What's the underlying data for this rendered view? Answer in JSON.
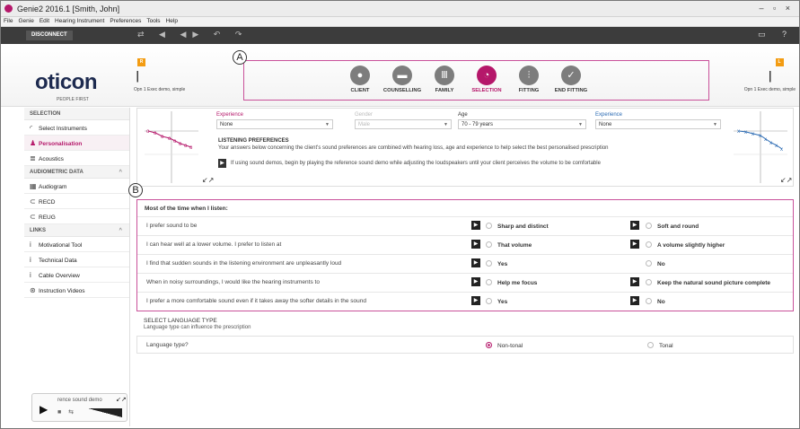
{
  "window": {
    "title": "Genie2 2016.1 [Smith, John]",
    "controls": "– ▫ ×"
  },
  "menu": [
    "File",
    "Genie",
    "Edit",
    "Hearing Instrument",
    "Preferences",
    "Tools",
    "Help"
  ],
  "toolbar": {
    "disconnect_label": "DISCONNECT",
    "icons": "⇄ ◀ ◀▶ ↶ ↷",
    "right_icons": "▭ ?"
  },
  "brand": {
    "logo": "oticon",
    "tagline": "PEOPLE FIRST"
  },
  "left_instrument": {
    "badge": "R",
    "label": "Opn 1 Exec demo, simple"
  },
  "right_instrument": {
    "badge": "L",
    "label": "Opn 1 Exec demo, simple"
  },
  "callouts": {
    "a": "A",
    "b": "B"
  },
  "steps": [
    {
      "label": "CLIENT",
      "icon": "person-icon",
      "glyph": "●"
    },
    {
      "label": "COUNSELLING",
      "icon": "chat-icon",
      "glyph": "▬"
    },
    {
      "label": "FAMILY",
      "icon": "family-icon",
      "glyph": "Ⅲ"
    },
    {
      "label": "SELECTION",
      "icon": "selection-icon",
      "glyph": "◔"
    },
    {
      "label": "FITTING",
      "icon": "sliders-icon",
      "glyph": "⫶"
    },
    {
      "label": "END FITTING",
      "icon": "check-icon",
      "glyph": "✓"
    }
  ],
  "colors": {
    "accent": "#b5176a",
    "right_ear": "#2a6ab3",
    "left_ear": "#c0392b"
  },
  "sidebar": {
    "selection": {
      "header": "SELECTION",
      "items": [
        {
          "label": "Select Instruments",
          "icon": "◜"
        },
        {
          "label": "Personalisation",
          "icon": "♟"
        },
        {
          "label": "Acoustics",
          "icon": "≣"
        }
      ]
    },
    "audiometric": {
      "header": "AUDIOMETRIC DATA",
      "caret": "^",
      "items": [
        {
          "label": "Audiogram",
          "icon": "▦"
        },
        {
          "label": "RECD",
          "icon": "⊂"
        },
        {
          "label": "REUG",
          "icon": "⊂"
        }
      ]
    },
    "links": {
      "header": "LINKS",
      "caret": "^",
      "items": [
        {
          "label": "Motivational Tool",
          "icon": "i"
        },
        {
          "label": "Technical Data",
          "icon": "i"
        },
        {
          "label": "Cable Overview",
          "icon": "i"
        },
        {
          "label": "Instruction Videos",
          "icon": "⊛"
        }
      ]
    },
    "sound_demo": {
      "label": "rence sound demo",
      "play": "▶",
      "ctrls": "■ ⇆",
      "expand": "↙↗"
    }
  },
  "profile": {
    "experience_left_label": "Experience",
    "experience_left_value": "None",
    "gender_label": "Gender",
    "gender_value": "Male",
    "age_label": "Age",
    "age_value": "70 - 79 years",
    "experience_right_label": "Experience",
    "experience_right_value": "None",
    "dropdown_arrow": "▼"
  },
  "listening": {
    "title": "LISTENING PREFERENCES",
    "desc": "Your answers below concerning the client's sound preferences are combined with hearing loss, age and experience to help select the best personalised prescription",
    "play": "▶",
    "hint": "If using sound demos, begin by playing the reference sound demo while adjusting the loudspeakers until your client perceives the volume to be comfortable",
    "expand": "↙↗"
  },
  "preferences": {
    "title": "Most of the time when I listen:",
    "play": "▶",
    "rows": [
      {
        "question": "I prefer sound to be",
        "option_a": "Sharp and distinct",
        "option_b": "Soft and round",
        "play_a": true,
        "play_b": true
      },
      {
        "question": "I can hear well at a lower volume. I prefer to listen at",
        "option_a": "That volume",
        "option_b": "A volume slightly higher",
        "play_a": true,
        "play_b": true
      },
      {
        "question": "I find that sudden sounds in the listening environment are unpleasantly loud",
        "option_a": "Yes",
        "option_b": "No",
        "play_a": true,
        "play_b": false
      },
      {
        "question": "When in noisy surroundings, I would like the hearing instruments to",
        "option_a": "Help me focus",
        "option_b": "Keep the natural sound picture complete",
        "play_a": true,
        "play_b": true
      },
      {
        "question": "I prefer a more comfortable sound even if it takes away the softer details in the sound",
        "option_a": "Yes",
        "option_b": "No",
        "play_a": true,
        "play_b": true
      }
    ]
  },
  "language": {
    "title": "SELECT LANGUAGE TYPE",
    "subtitle": "Language type can influence the prescription",
    "question": "Language type?",
    "option_a": "Non-tonal",
    "option_b": "Tonal",
    "selected": "option_a"
  }
}
